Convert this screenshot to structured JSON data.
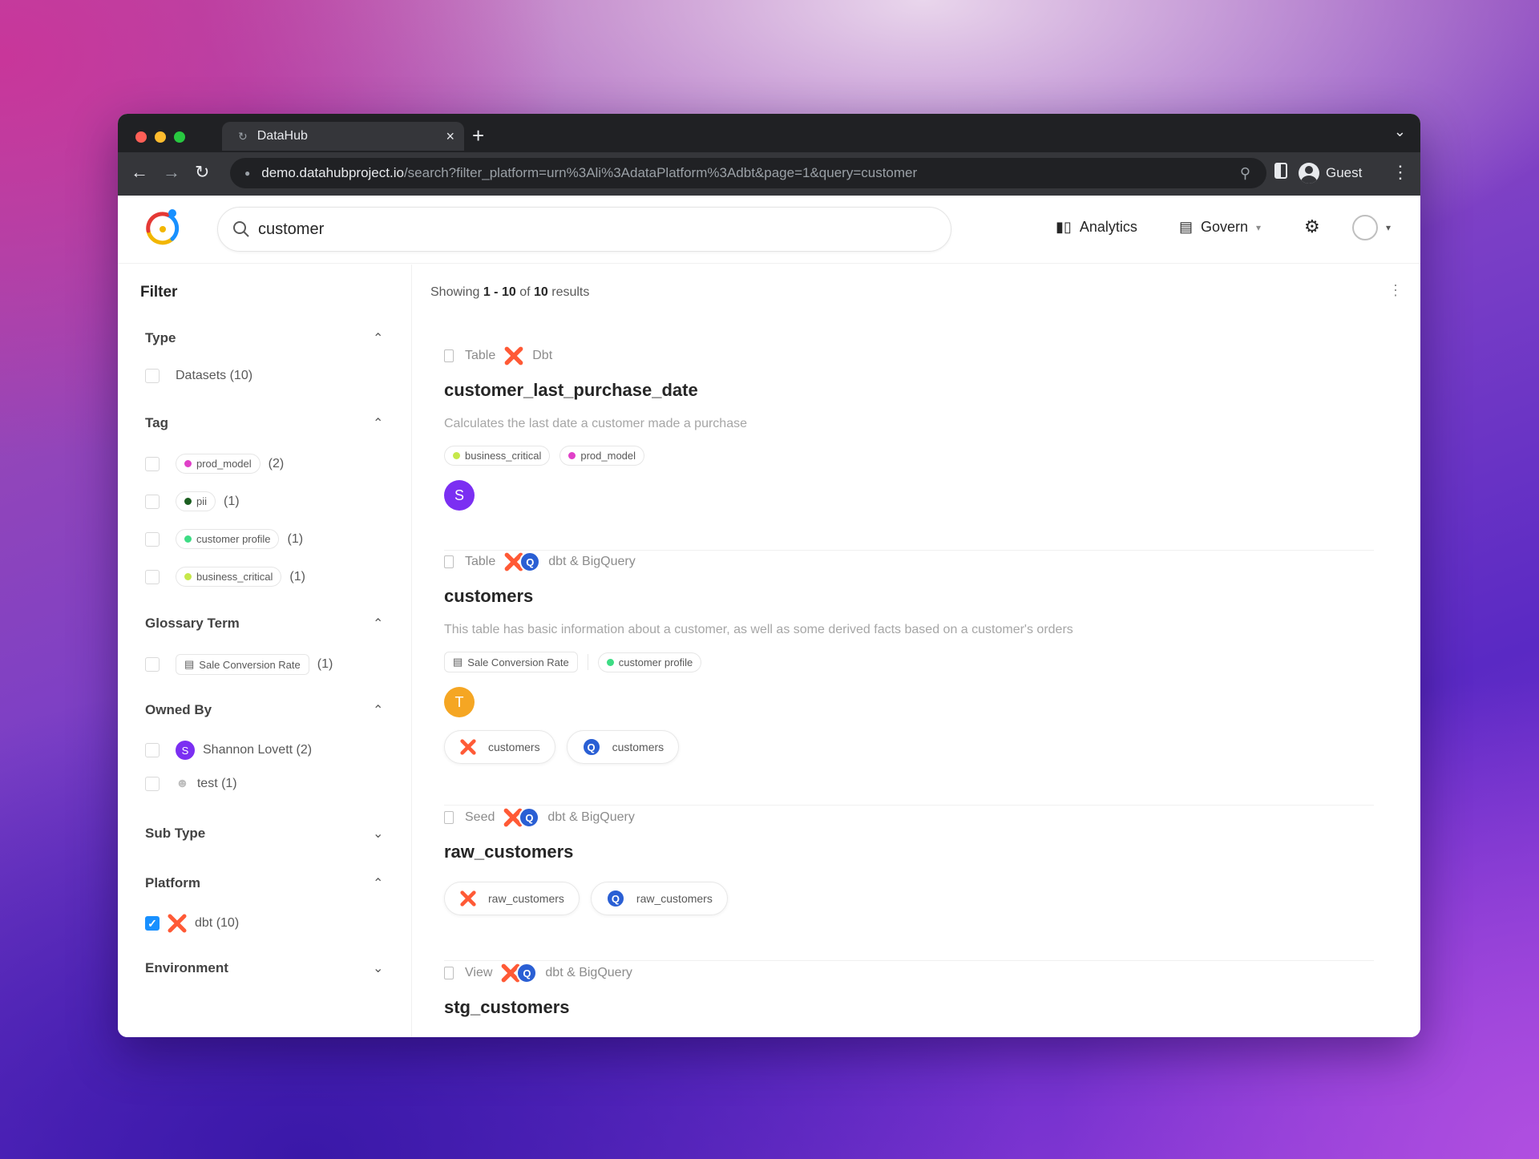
{
  "browser": {
    "tab_title": "DataHub",
    "url_host": "demo.datahubproject.io",
    "url_path": "/search?filter_platform=urn%3Ali%3AdataPlatform%3Adbt&page=1&query=customer",
    "profile": "Guest"
  },
  "header": {
    "search_value": "customer",
    "analytics_label": "Analytics",
    "govern_label": "Govern"
  },
  "sidebar": {
    "title": "Filter",
    "type": {
      "label": "Type",
      "items": [
        {
          "label": "Datasets (10)"
        }
      ]
    },
    "tag": {
      "label": "Tag",
      "items": [
        {
          "label": "prod_model",
          "count": "(2)",
          "color": "#e040c8"
        },
        {
          "label": "pii",
          "count": "(1)",
          "color": "#1b5e20"
        },
        {
          "label": "customer profile",
          "count": "(1)",
          "color": "#3ddc84"
        },
        {
          "label": "business_critical",
          "count": "(1)",
          "color": "#c6e84a"
        }
      ]
    },
    "glossary": {
      "label": "Glossary Term",
      "item": "Sale Conversion Rate",
      "count": "(1)"
    },
    "owned_by": {
      "label": "Owned By",
      "items": [
        {
          "avatar": "S",
          "label": "Shannon Lovett (2)"
        },
        {
          "label": "test (1)"
        }
      ]
    },
    "sub_type": {
      "label": "Sub Type"
    },
    "platform": {
      "label": "Platform",
      "item": "dbt (10)"
    },
    "environment": {
      "label": "Environment"
    }
  },
  "results": {
    "showing_prefix": "Showing",
    "range": "1 - 10",
    "of": "of",
    "total": "10",
    "suffix": "results",
    "items": [
      {
        "type": "Table",
        "platform": "Dbt",
        "title": "customer_last_purchase_date",
        "description": "Calculates the last date a customer made a purchase",
        "tags": [
          {
            "label": "business_critical",
            "color": "#c6e84a"
          },
          {
            "label": "prod_model",
            "color": "#e040c8"
          }
        ],
        "owner": "S",
        "owner_color": "#7b2ff2"
      },
      {
        "type": "Table",
        "platform": "dbt & BigQuery",
        "title": "customers",
        "description": "This table has basic information about a customer, as well as some derived facts based on a customer's orders",
        "glossary": "Sale Conversion Rate",
        "tags": [
          {
            "label": "customer profile",
            "color": "#3ddc84"
          }
        ],
        "owner": "T",
        "owner_color": "#f5a623",
        "entities": [
          "customers",
          "customers"
        ]
      },
      {
        "type": "Seed",
        "platform": "dbt & BigQuery",
        "title": "raw_customers",
        "entities": [
          "raw_customers",
          "raw_customers"
        ]
      },
      {
        "type": "View",
        "platform": "dbt & BigQuery",
        "title": "stg_customers"
      }
    ]
  }
}
